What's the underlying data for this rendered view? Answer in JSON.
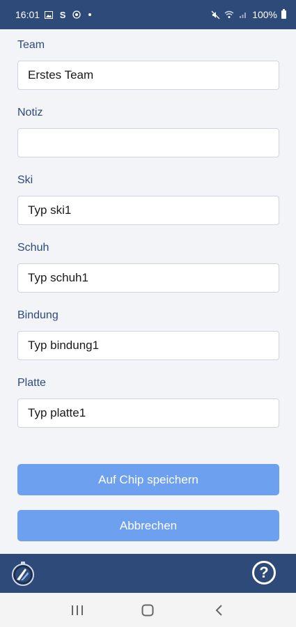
{
  "status_bar": {
    "time": "16:01",
    "battery": "100%",
    "icons": [
      "image-icon",
      "s-app-icon",
      "sync-icon",
      "dot-icon",
      "mute-icon",
      "wifi-icon",
      "signal-icon",
      "battery-icon"
    ]
  },
  "form": {
    "fields": [
      {
        "label": "Team",
        "value": "Erstes Team",
        "placeholder": ""
      },
      {
        "label": "Notiz",
        "value": "",
        "placeholder": ""
      },
      {
        "label": "Ski",
        "value": "Typ ski1",
        "placeholder": ""
      },
      {
        "label": "Schuh",
        "value": "Typ schuh1",
        "placeholder": ""
      },
      {
        "label": "Bindung",
        "value": "Typ bindung1",
        "placeholder": ""
      },
      {
        "label": "Platte",
        "value": "Typ platte1",
        "placeholder": ""
      }
    ],
    "save_label": "Auf Chip speichern",
    "cancel_label": "Abbrechen"
  },
  "app_bar": {
    "logo_icon": "app-logo-icon",
    "help_icon": "help-circle-icon",
    "help_glyph": "?"
  },
  "nav_bar": {
    "recent_icon": "recent-apps-icon",
    "home_icon": "home-icon",
    "back_icon": "back-icon"
  },
  "colors": {
    "primary": "#2e4a78",
    "button": "#6ea0f0",
    "label": "#2e4a78",
    "background": "#f2f4f8"
  }
}
